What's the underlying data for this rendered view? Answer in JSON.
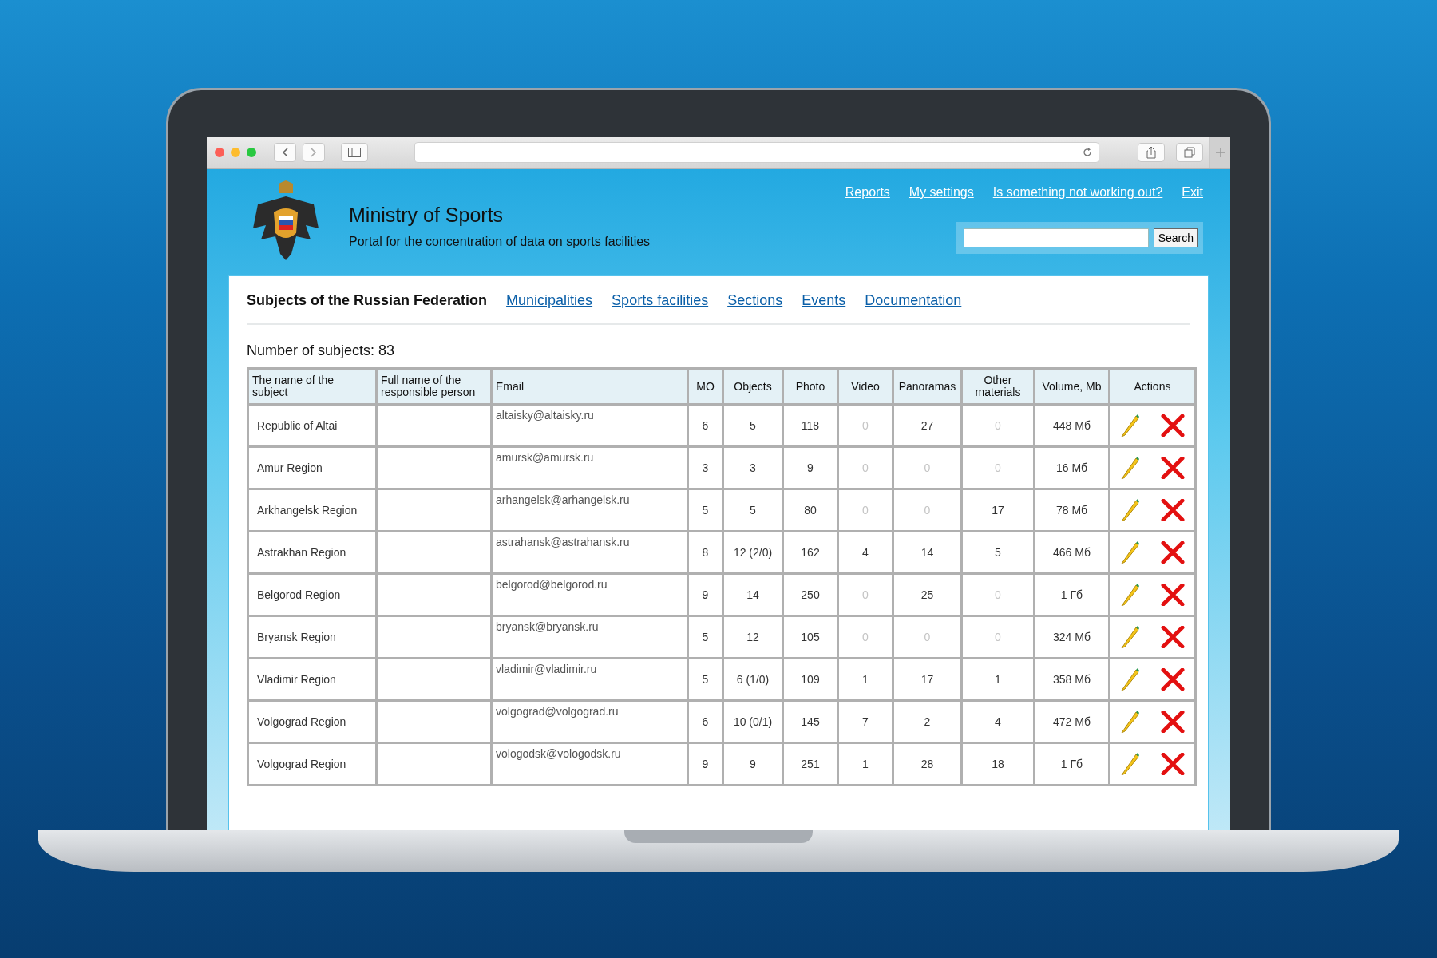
{
  "site": {
    "title": "Ministry of Sports",
    "subtitle": "Portal for the concentration of data on sports facilities"
  },
  "top_links": [
    "Reports",
    "My settings",
    "Is something not working out?",
    "Exit"
  ],
  "search": {
    "button": "Search"
  },
  "tabs": [
    {
      "label": "Subjects of the Russian Federation",
      "selected": true
    },
    {
      "label": "Municipalities",
      "selected": false
    },
    {
      "label": "Sports facilities",
      "selected": false
    },
    {
      "label": "Sections",
      "selected": false
    },
    {
      "label": "Events",
      "selected": false
    },
    {
      "label": "Documentation",
      "selected": false
    }
  ],
  "count": "Number of subjects: 83",
  "table": {
    "columns": [
      "The name of the subject",
      "Full name of the responsible person",
      "Email",
      "MO",
      "Objects",
      "Photo",
      "Video",
      "Panoramas",
      "Other materials",
      "Volume, Mb",
      "Actions"
    ],
    "rows": [
      {
        "name": "Republic of Altai",
        "email": "altaisky@altaisky.ru",
        "values": [
          "6",
          "5",
          "118",
          {
            "text": "0",
            "dim": true
          },
          "27",
          {
            "text": "0",
            "dim": true
          },
          "448 Мб"
        ]
      },
      {
        "name": "Amur Region",
        "email": "amursk@amursk.ru",
        "values": [
          "3",
          "3",
          "9",
          {
            "text": "0",
            "dim": true
          },
          {
            "text": "0",
            "dim": true
          },
          {
            "text": "0",
            "dim": true
          },
          "16 Мб"
        ]
      },
      {
        "name": "Arkhangelsk Region",
        "email": "arhangelsk@arhangelsk.ru",
        "values": [
          "5",
          "5",
          "80",
          {
            "text": "0",
            "dim": true
          },
          {
            "text": "0",
            "dim": true
          },
          "17",
          "78 Мб"
        ]
      },
      {
        "name": "Astrakhan Region",
        "email": "astrahansk@astrahansk.ru",
        "values": [
          "8",
          "12 (2/0)",
          "162",
          "4",
          "14",
          "5",
          "466 Мб"
        ]
      },
      {
        "name": "Belgorod Region",
        "email": "belgorod@belgorod.ru",
        "values": [
          "9",
          "14",
          "250",
          {
            "text": "0",
            "dim": true
          },
          "25",
          {
            "text": "0",
            "dim": true
          },
          "1 Гб"
        ]
      },
      {
        "name": "Bryansk Region",
        "email": "bryansk@bryansk.ru",
        "values": [
          "5",
          "12",
          "105",
          {
            "text": "0",
            "dim": true
          },
          {
            "text": "0",
            "dim": true
          },
          {
            "text": "0",
            "dim": true
          },
          "324 Мб"
        ]
      },
      {
        "name": "Vladimir Region",
        "email": "vladimir@vladimir.ru",
        "values": [
          "5",
          "6 (1/0)",
          "109",
          "1",
          "17",
          "1",
          "358 Мб"
        ]
      },
      {
        "name": "Volgograd Region",
        "email": "volgograd@volgograd.ru",
        "values": [
          "6",
          "10 (0/1)",
          "145",
          "7",
          "2",
          "4",
          "472 Мб"
        ]
      },
      {
        "name": "Volgograd Region",
        "email": "vologodsk@vologodsk.ru",
        "values": [
          "9",
          "9",
          "251",
          "1",
          "28",
          "18",
          "1 Гб"
        ]
      }
    ]
  }
}
